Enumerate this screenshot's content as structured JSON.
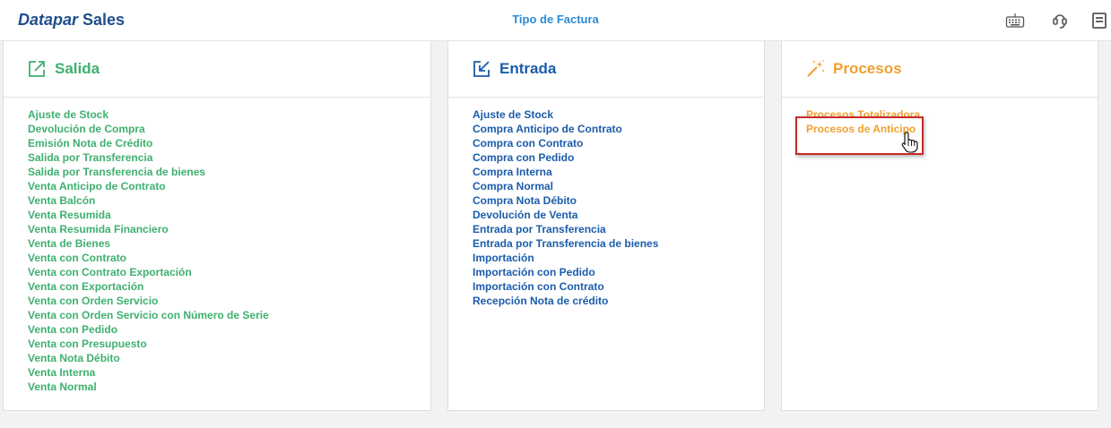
{
  "header": {
    "brand_italic": "Datapar",
    "brand_bold": "Sales",
    "title": "Tipo de Factura",
    "icons": [
      "keyboard-icon",
      "support-icon",
      "document-icon"
    ]
  },
  "colors": {
    "salida": "#3fb06f",
    "entrada": "#1b5cab",
    "procesos": "#f0a030",
    "highlight": "#c62b2b"
  },
  "salida": {
    "title": "Salida",
    "icon": "external-link-icon",
    "items": [
      "Ajuste de Stock",
      "Devolución de Compra",
      "Emisión Nota de Crédito",
      "Salida por Transferencia",
      "Salida por Transferencia de bienes",
      "Venta Anticipo de Contrato",
      "Venta Balcón",
      "Venta Resumida",
      "Venta Resumida Financiero",
      "Venta de Bienes",
      "Venta con Contrato",
      "Venta con Contrato Exportación",
      "Venta con Exportación",
      "Venta con Orden Servicio",
      "Venta con Orden Servicio con Número de Serie",
      "Venta con Pedido",
      "Venta con Presupuesto",
      "Venta Nota Débito",
      "Venta Interna",
      "Venta Normal"
    ]
  },
  "entrada": {
    "title": "Entrada",
    "icon": "import-icon",
    "items": [
      "Ajuste de Stock",
      "Compra Anticipo de Contrato",
      "Compra con Contrato",
      "Compra con Pedido",
      "Compra Interna",
      "Compra Normal",
      "Compra Nota Débito",
      "Devolución de Venta",
      "Entrada por Transferencia",
      "Entrada por Transferencia de bienes",
      "Importación",
      "Importación con Pedido",
      "Importación con Contrato",
      "Recepción Nota de crédito"
    ]
  },
  "procesos": {
    "title": "Procesos",
    "icon": "magic-wand-icon",
    "items": [
      "Procesos Totalizadora",
      "Procesos de Anticipo"
    ]
  }
}
